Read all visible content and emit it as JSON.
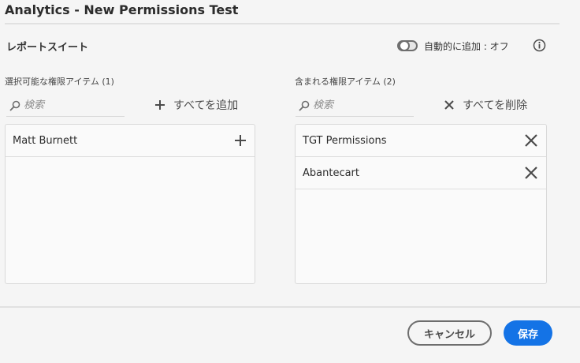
{
  "dialog": {
    "title": "Analytics - New Permissions Test"
  },
  "section": {
    "label": "レポートスイート",
    "auto_add_label": "自動的に追加 : オフ"
  },
  "available": {
    "label": "選択可能な権限アイテム (1)",
    "search_placeholder": "検索",
    "add_all_label": "すべてを追加",
    "items": [
      {
        "name": "Matt Burnett"
      }
    ]
  },
  "included": {
    "label": "含まれる権限アイテム (2)",
    "search_placeholder": "検索",
    "remove_all_label": "すべてを削除",
    "items": [
      {
        "name": "TGT Permissions"
      },
      {
        "name": "Abantecart"
      }
    ]
  },
  "footer": {
    "cancel_label": "キャンセル",
    "save_label": "保存"
  },
  "colors": {
    "primary": "#1473e6",
    "border": "#d9d9d9",
    "icon": "#4b4b4b"
  }
}
